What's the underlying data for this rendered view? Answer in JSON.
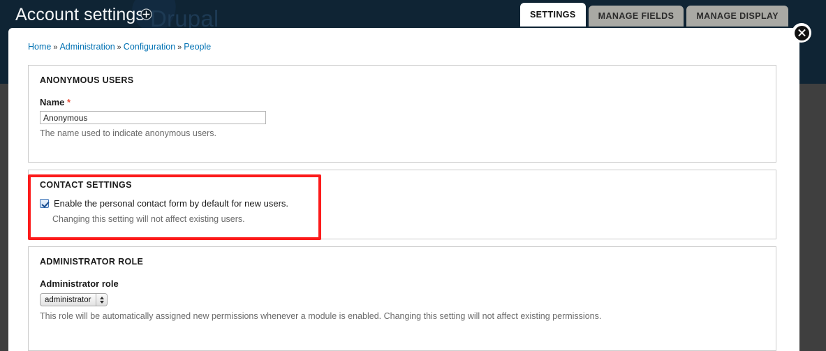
{
  "header": {
    "title": "Account settings",
    "watermark": "Drupal",
    "target_icon": "target-icon"
  },
  "tabs": [
    {
      "label": "SETTINGS",
      "active": true
    },
    {
      "label": "MANAGE FIELDS",
      "active": false
    },
    {
      "label": "MANAGE DISPLAY",
      "active": false
    }
  ],
  "close_button": {
    "label": "close"
  },
  "breadcrumb": {
    "items": [
      "Home",
      "Administration",
      "Configuration",
      "People"
    ],
    "separator": "»"
  },
  "sections": {
    "anonymous": {
      "legend": "ANONYMOUS USERS",
      "name_label": "Name",
      "required_marker": "*",
      "name_value": "Anonymous",
      "name_placeholder": "Anonymous",
      "name_description": "The name used to indicate anonymous users."
    },
    "contact": {
      "legend": "CONTACT SETTINGS",
      "checkbox_label": "Enable the personal contact form by default for new users.",
      "checkbox_checked": true,
      "description": "Changing this setting will not affect existing users."
    },
    "administrator": {
      "legend": "ADMINISTRATOR ROLE",
      "field_label": "Administrator role",
      "selected_option": "administrator",
      "options": [
        "administrator"
      ],
      "description": "This role will be automatically assigned new permissions whenever a module is enabled. Changing this setting will not affect existing permissions."
    }
  },
  "colors": {
    "header_bg": "#0f2434",
    "page_bg": "#3f3f3f",
    "link": "#0071b3",
    "highlight": "#fc1b1b",
    "required": "#e8503a",
    "tab_inactive": "#a9a9a4"
  }
}
